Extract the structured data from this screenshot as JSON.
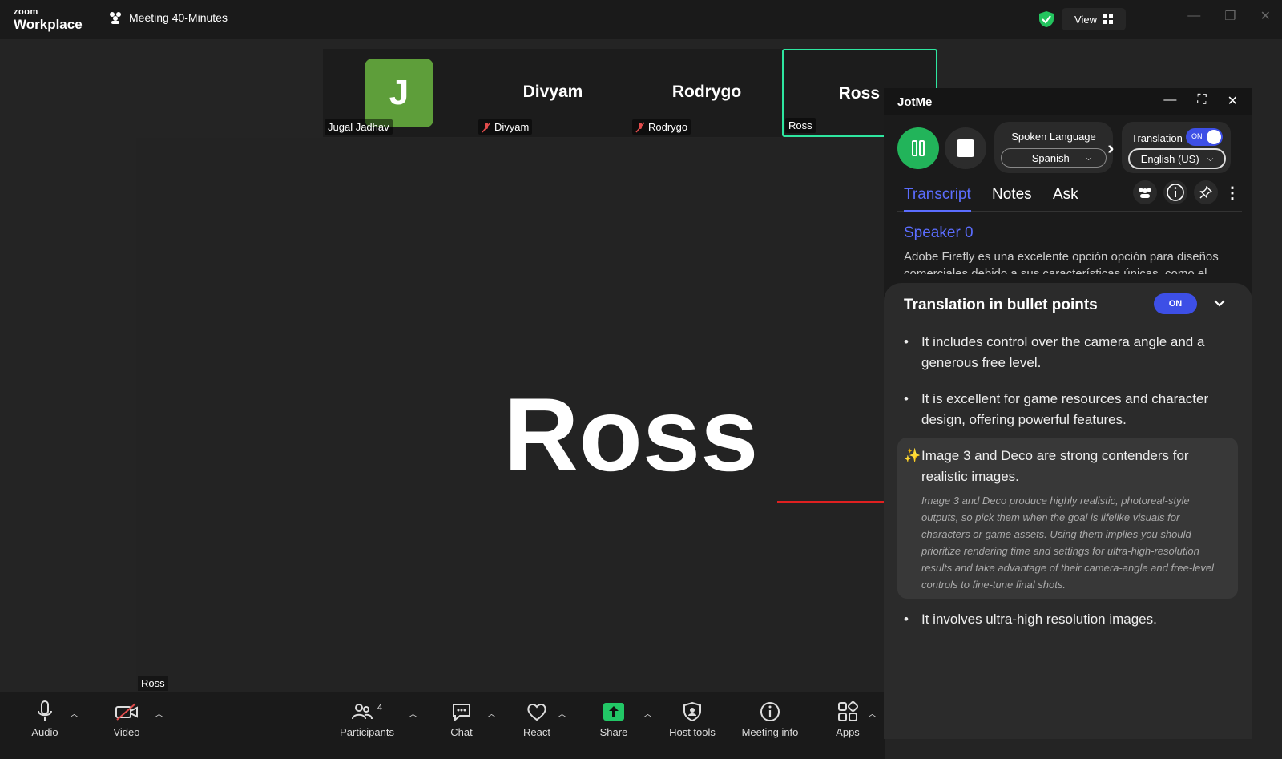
{
  "app": {
    "logo_small": "zoom",
    "logo_big": "Workplace",
    "meeting_title": "Meeting 40-Minutes",
    "view_label": "View"
  },
  "gallery": [
    {
      "name": "",
      "label": "Jugal Jadhav",
      "initial": "J"
    },
    {
      "name": "Divyam",
      "label": "Divyam"
    },
    {
      "name": "Rodrygo",
      "label": "Rodrygo"
    },
    {
      "name": "Ross",
      "label": "Ross"
    }
  ],
  "main": {
    "name": "Ross",
    "label": "Ross"
  },
  "toolbar": {
    "audio": "Audio",
    "video": "Video",
    "participants": "Participants",
    "participants_count": "4",
    "chat": "Chat",
    "react": "React",
    "share": "Share",
    "host_tools": "Host tools",
    "meeting_info": "Meeting info",
    "apps": "Apps"
  },
  "jotme": {
    "title": "JotMe",
    "spoken_language_label": "Spoken Language",
    "spoken_language": "Spanish",
    "translation_label": "Translation",
    "translation_toggle": "ON",
    "translation_language": "English (US)",
    "tabs": [
      "Transcript",
      "Notes",
      "Ask"
    ],
    "speaker": "Speaker 0",
    "transcript": "Adobe Firefly es una excelente opción opción para diseños comerciales debido a sus características únicas, como el",
    "bullets_title": "Translation in bullet points",
    "bullets_toggle": "ON",
    "bullets": [
      "It includes control over the camera angle and a generous free level.",
      "It is excellent for game resources and character design, offering powerful features.",
      "It involves ultra-high resolution images."
    ],
    "highlight_main": "Image 3 and Deco are strong contenders for realistic images.",
    "highlight_detail": "Image 3 and Deco produce highly realistic, photoreal-style outputs, so pick them when the goal is lifelike visuals for characters or game assets. Using them implies you should prioritize rendering time and settings for ultra-high-resolution results and take advantage of their camera-angle and free-level controls to fine-tune final shots."
  }
}
